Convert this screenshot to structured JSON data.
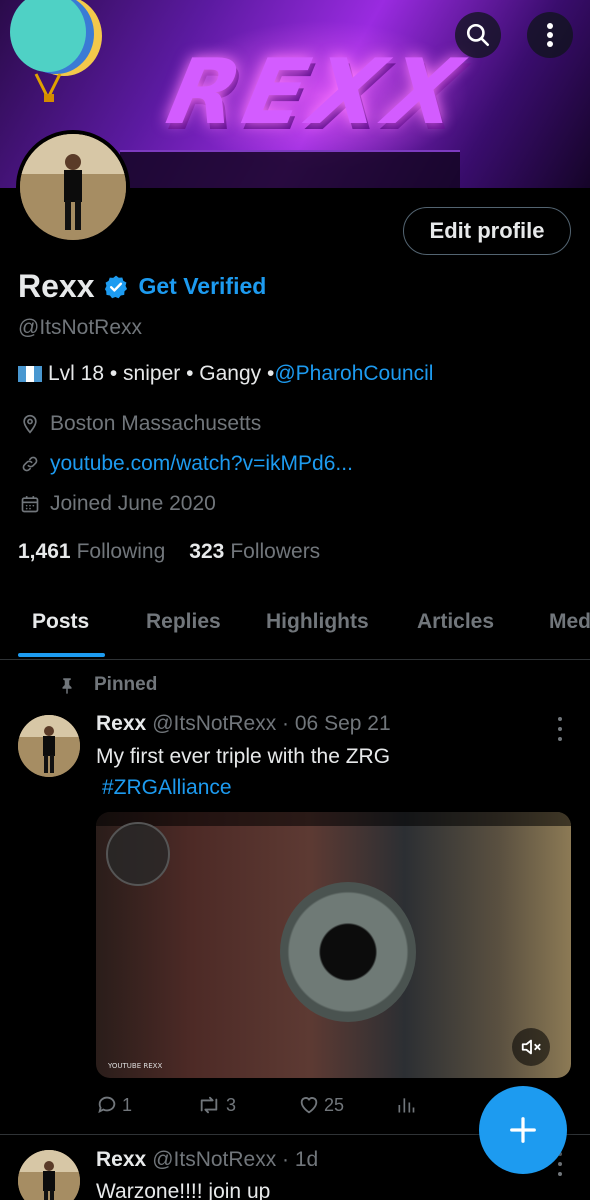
{
  "profile": {
    "banner_text": "REXX",
    "display_name": "Rexx",
    "get_verified": "Get Verified",
    "handle": "@ItsNotRexx",
    "bio_text": "Lvl 18 • sniper • Gangy • ",
    "bio_mention": "@PharohCouncil",
    "location": "Boston Massachusetts",
    "website": "youtube.com/watch?v=ikMPd6...",
    "joined": "Joined June 2020",
    "following_count": "1,461",
    "following_label": "Following",
    "followers_count": "323",
    "followers_label": "Followers",
    "edit_profile_label": "Edit profile"
  },
  "tabs": [
    {
      "label": "Posts",
      "active": true
    },
    {
      "label": "Replies"
    },
    {
      "label": "Highlights"
    },
    {
      "label": "Articles"
    },
    {
      "label": "Med"
    }
  ],
  "pinned_label": "Pinned",
  "posts": [
    {
      "name": "Rexx",
      "meta": "@ItsNotRexx · 06 Sep 21",
      "text_line1": "My first ever triple with the ZRG",
      "hashtag": "#ZRGAlliance",
      "media_label": "YOUTUBE REXX",
      "replies": "1",
      "reposts": "3",
      "likes": "25"
    },
    {
      "name": "Rexx",
      "meta": "@ItsNotRexx · 1d",
      "text_line1": "Warzone!!!! join up"
    }
  ],
  "icons": {
    "search": "search-icon",
    "more": "more-vertical-icon",
    "verified": "verified-badge-icon",
    "location": "location-pin-icon",
    "link": "link-icon",
    "calendar": "calendar-icon",
    "pin": "pin-icon",
    "reply": "reply-icon",
    "repost": "repost-icon",
    "like": "heart-icon",
    "views": "analytics-icon",
    "mute": "muted-speaker-icon",
    "compose": "plus-icon"
  },
  "colors": {
    "accent": "#1d9bf0",
    "text": "#e7e9ea",
    "muted": "#71767b",
    "background": "#000000"
  }
}
